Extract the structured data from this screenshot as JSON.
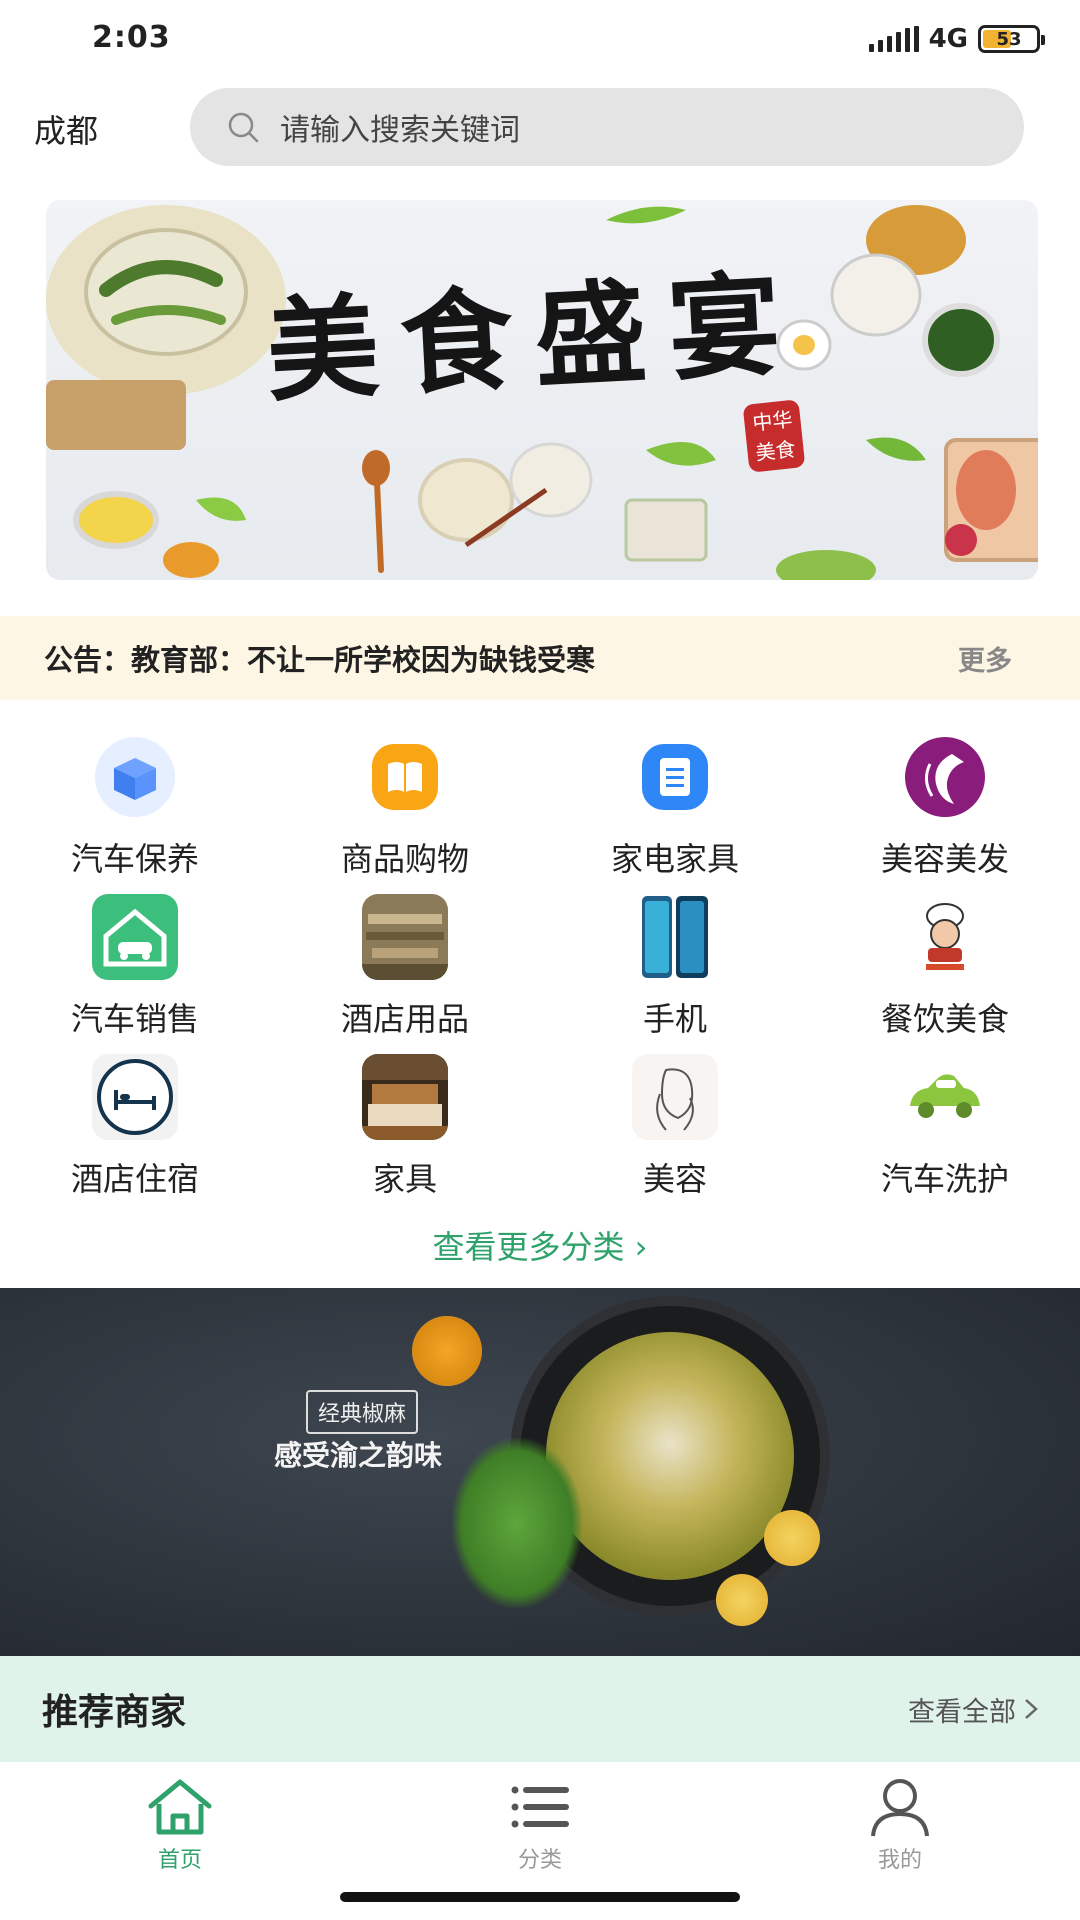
{
  "status_bar": {
    "time": "2:03",
    "network": "4G",
    "battery": "53",
    "battery_level": 0.53
  },
  "header": {
    "city": "成都",
    "search_placeholder": "请输入搜索关键词"
  },
  "banner_top": {
    "title": "美食盛宴",
    "stamp": "中华美食"
  },
  "notice": {
    "text": "公告：教育部：不让一所学校因为缺钱受寒",
    "more": "更多"
  },
  "categories": [
    {
      "label": "汽车保养",
      "icon": "car-maintenance-box-icon"
    },
    {
      "label": "商品购物",
      "icon": "shopping-book-icon"
    },
    {
      "label": "家电家具",
      "icon": "appliance-clipboard-icon"
    },
    {
      "label": "美容美发",
      "icon": "hairdressing-icon"
    },
    {
      "label": "汽车销售",
      "icon": "car-sales-icon"
    },
    {
      "label": "酒店用品",
      "icon": "hotel-supplies-icon"
    },
    {
      "label": "手机",
      "icon": "phone-icon"
    },
    {
      "label": "餐饮美食",
      "icon": "catering-chef-icon"
    },
    {
      "label": "酒店住宿",
      "icon": "hotel-bed-icon"
    },
    {
      "label": "家具",
      "icon": "furniture-icon"
    },
    {
      "label": "美容",
      "icon": "beauty-icon"
    },
    {
      "label": "汽车洗护",
      "icon": "car-wash-icon"
    }
  ],
  "more_categories": "查看更多分类 ›",
  "banner_promo": {
    "tag": "经典椒麻",
    "headline": "感受渝之韵味"
  },
  "recommend": {
    "title": "推荐商家",
    "view_all": "查看全部"
  },
  "bottom_nav": [
    {
      "label": "首页",
      "icon": "home-icon",
      "active": true
    },
    {
      "label": "分类",
      "icon": "list-icon",
      "active": false
    },
    {
      "label": "我的",
      "icon": "user-icon",
      "active": false
    }
  ],
  "colors": {
    "accent": "#2fa26b",
    "inactive": "#999999",
    "notice_bg": "#fdf6e4",
    "recommend_bg": "#dff3ea"
  }
}
